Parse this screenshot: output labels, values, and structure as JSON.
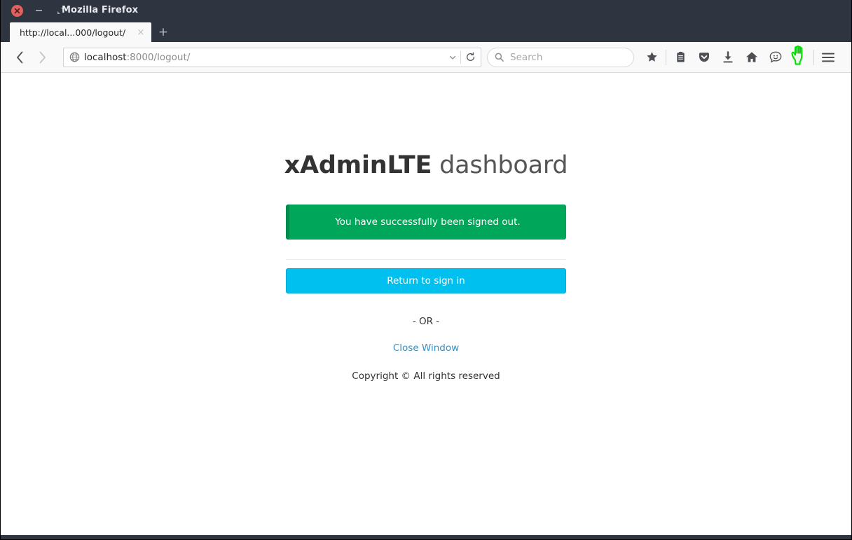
{
  "window": {
    "title": "Mozilla Firefox",
    "controls": {
      "close": "close-window",
      "minimize": "minimize-window",
      "maximize": "maximize-window"
    }
  },
  "tabs": {
    "items": [
      {
        "label": "http://local...000/logout/",
        "close_label": "×"
      }
    ],
    "new_tab_label": "+"
  },
  "toolbar": {
    "back_label": "‹",
    "forward_label": "›",
    "url": {
      "host": "localhost",
      "path": ":8000/logout/",
      "dropdown_icon": "chevron-down-icon",
      "reload_icon": "reload-icon",
      "identity_icon": "globe-icon"
    },
    "search": {
      "placeholder": "Search",
      "value": "",
      "icon": "search-icon"
    },
    "icons": [
      {
        "name": "bookmark-star-icon",
        "glyph": "star"
      },
      {
        "name": "library-icon",
        "glyph": "library"
      },
      {
        "name": "pocket-icon",
        "glyph": "pocket"
      },
      {
        "name": "downloads-icon",
        "glyph": "download"
      },
      {
        "name": "home-icon",
        "glyph": "home"
      },
      {
        "name": "feedback-smiley-icon",
        "glyph": "smiley"
      },
      {
        "name": "hand-cursor",
        "glyph": "hand"
      }
    ],
    "menu_icon": "hamburger-menu-icon"
  },
  "page": {
    "brand": {
      "bold": "xAdminLTE",
      "light": " dashboard"
    },
    "alert": {
      "message": "You have successfully been signed out."
    },
    "primary_button": {
      "label": "Return to sign in"
    },
    "or_text": "- OR -",
    "close_window_link": "Close Window",
    "copyright": "Copyright © All rights reserved"
  },
  "colors": {
    "chrome_dark": "#2e3440",
    "alert_green": "#00a65a",
    "alert_green_border": "#008d4c",
    "button_blue": "#00c0ef",
    "link_blue": "#3c8dbc",
    "close_button_red": "#e0615f",
    "cursor_outline_green": "#00e000"
  }
}
